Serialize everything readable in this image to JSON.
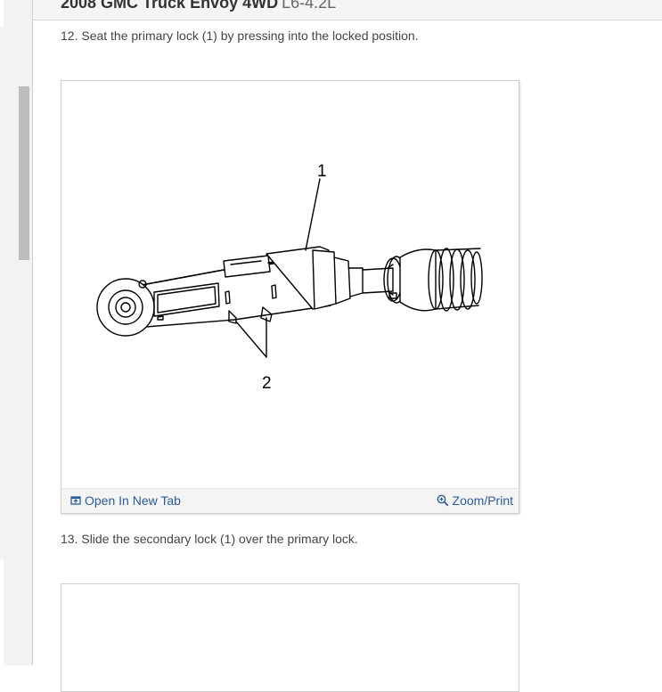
{
  "header": {
    "vehicle": "2008 GMC Truck Envoy 4WD",
    "engine": "L6-4.2L"
  },
  "steps": [
    {
      "text": "12. Seat the primary lock (1) by pressing into the locked position.",
      "figure": {
        "callouts": [
          "1",
          "2"
        ],
        "open_label": "Open In New Tab",
        "zoom_label": "Zoom/Print"
      }
    },
    {
      "text": "13. Slide the secondary lock (1) over the primary lock."
    }
  ],
  "icons": {
    "open": "open-in-new-tab-icon",
    "zoom": "zoom-in-icon"
  },
  "colors": {
    "link": "#2a5d9a",
    "rail": "#f2f2f2",
    "scroll_thumb": "#bdbdbd"
  }
}
